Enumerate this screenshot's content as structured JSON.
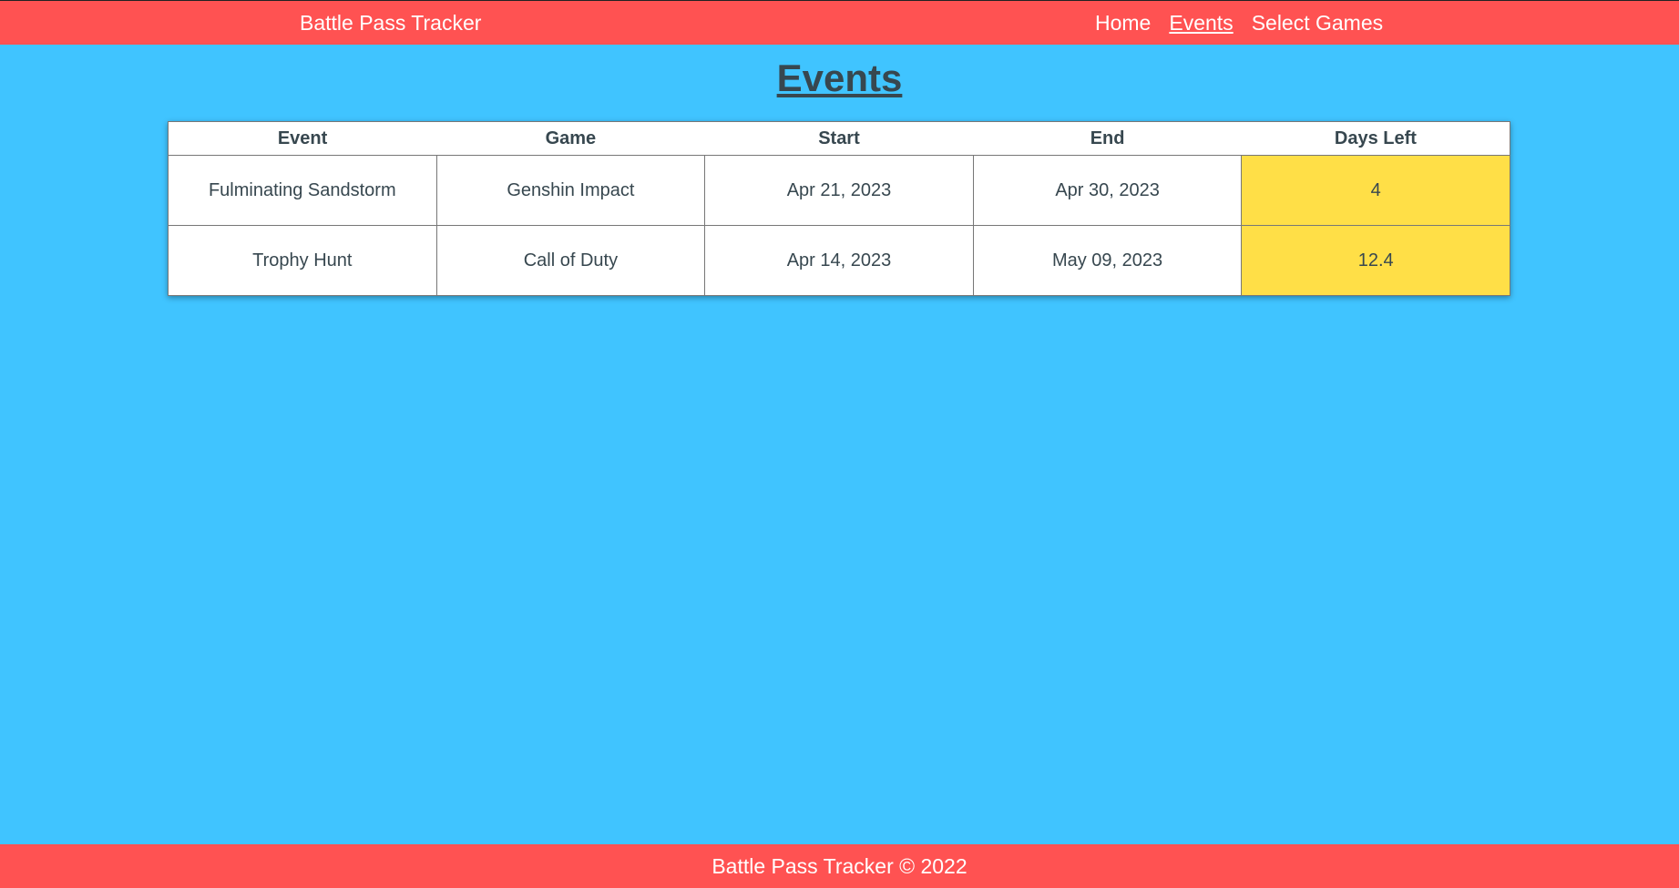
{
  "navbar": {
    "brand": "Battle Pass Tracker",
    "links": [
      {
        "label": "Home",
        "active": false
      },
      {
        "label": "Events",
        "active": true
      },
      {
        "label": "Select Games",
        "active": false
      }
    ]
  },
  "page": {
    "title": "Events"
  },
  "table": {
    "headers": [
      "Event",
      "Game",
      "Start",
      "End",
      "Days Left"
    ],
    "rows": [
      {
        "event": "Fulminating Sandstorm",
        "game": "Genshin Impact",
        "start": "Apr 21, 2023",
        "end": "Apr 30, 2023",
        "days_left": "4"
      },
      {
        "event": "Trophy Hunt",
        "game": "Call of Duty",
        "start": "Apr 14, 2023",
        "end": "May 09, 2023",
        "days_left": "12.4"
      }
    ]
  },
  "footer": {
    "text": "Battle Pass Tracker © 2022"
  },
  "colors": {
    "background": "#40c4ff",
    "header_footer": "#ff5252",
    "days_left_highlight": "#ffdf47",
    "text_dark": "#37474f"
  }
}
